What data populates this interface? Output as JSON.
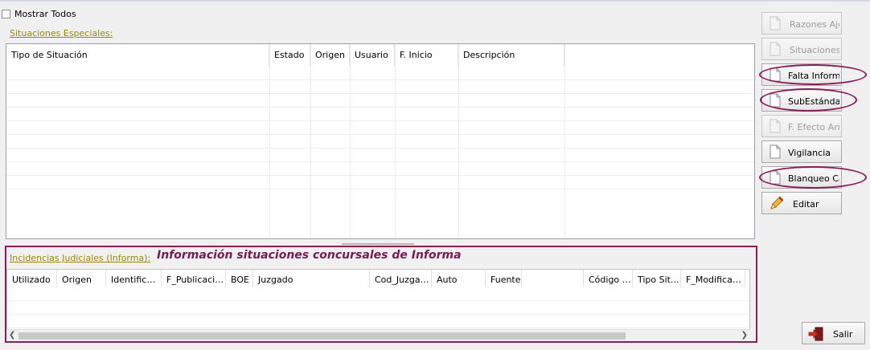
{
  "mostrar_todos": {
    "label": "Mostrar Todos",
    "checked": false
  },
  "situaciones_especiales": {
    "title": "Situaciones Especiales:",
    "columns": [
      "Tipo de Situación",
      "Estado",
      "Origen",
      "Usuario",
      "F. Inicio",
      "Descripción"
    ]
  },
  "incidencias": {
    "title": "Incidencias Judiciales (Informa):",
    "annotation": "Información situaciones concursales de Informa",
    "columns": [
      "Utilizado",
      "Origen",
      "Identificador",
      "F_Publicación",
      "BOE",
      "Juzgado",
      "Cod_Juzgado",
      "Auto",
      "Fuente",
      "",
      "Código I...",
      "Tipo Sit...",
      "F_Modificacion"
    ]
  },
  "buttons": {
    "razones_ajenas": "Razones Ajenas",
    "situaciones_be": "Situaciones BE",
    "falta_informacion": "Falta Información",
    "subestandar": "SubEstándar",
    "f_efecto_arrastre": "F. Efecto Arrastre",
    "vigilancia": "Vigilancia",
    "blanqueo_capital": "Blanqueo Capital",
    "editar": "Editar",
    "salir": "Salir"
  },
  "colors": {
    "annotation": "#8b1a57",
    "section_link": "#9b8a00",
    "disabled_text": "#9c9c9c"
  }
}
